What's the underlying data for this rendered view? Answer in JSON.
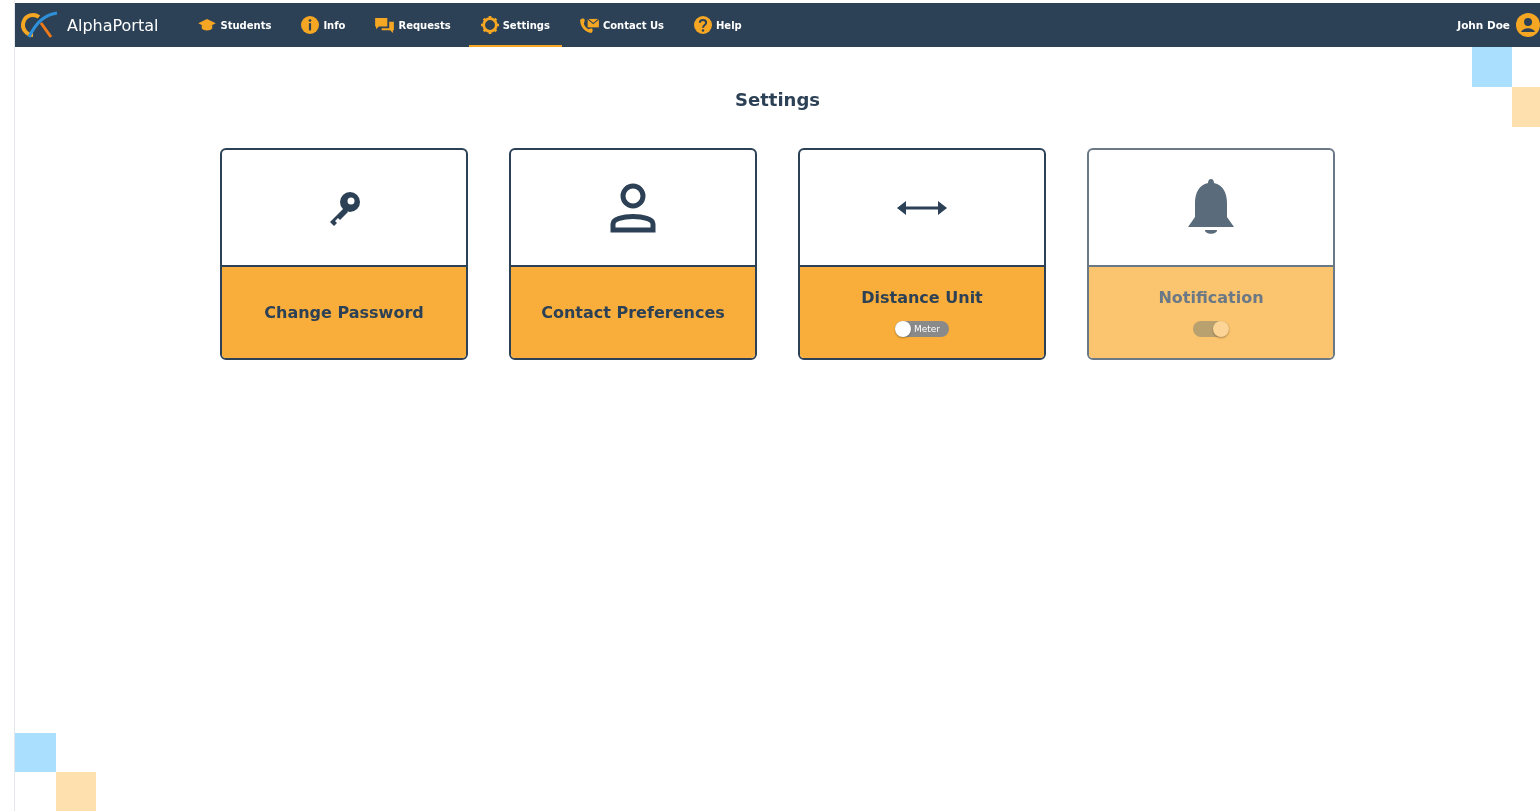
{
  "brand": {
    "name": "AlphaPortal"
  },
  "nav": [
    {
      "label": "Students",
      "kind": "cap",
      "selected": false
    },
    {
      "label": "Info",
      "kind": "info",
      "selected": false
    },
    {
      "label": "Requests",
      "kind": "chat",
      "selected": false
    },
    {
      "label": "Settings",
      "kind": "gear",
      "selected": true
    },
    {
      "label": "Contact Us",
      "kind": "phone",
      "selected": false
    },
    {
      "label": "Help",
      "kind": "help",
      "selected": false
    }
  ],
  "user": {
    "name": "John Doe"
  },
  "page_title": "Settings",
  "cards": [
    {
      "title": "Change Password",
      "kind": "key",
      "disabled": false
    },
    {
      "title": "Contact Preferences",
      "kind": "person",
      "disabled": false
    },
    {
      "title": "Distance Unit",
      "kind": "arrows",
      "disabled": false,
      "toggle": {
        "on": false,
        "label": "Meter"
      }
    },
    {
      "title": "Notification",
      "kind": "bell",
      "disabled": true,
      "toggle": {
        "on": true
      }
    }
  ]
}
